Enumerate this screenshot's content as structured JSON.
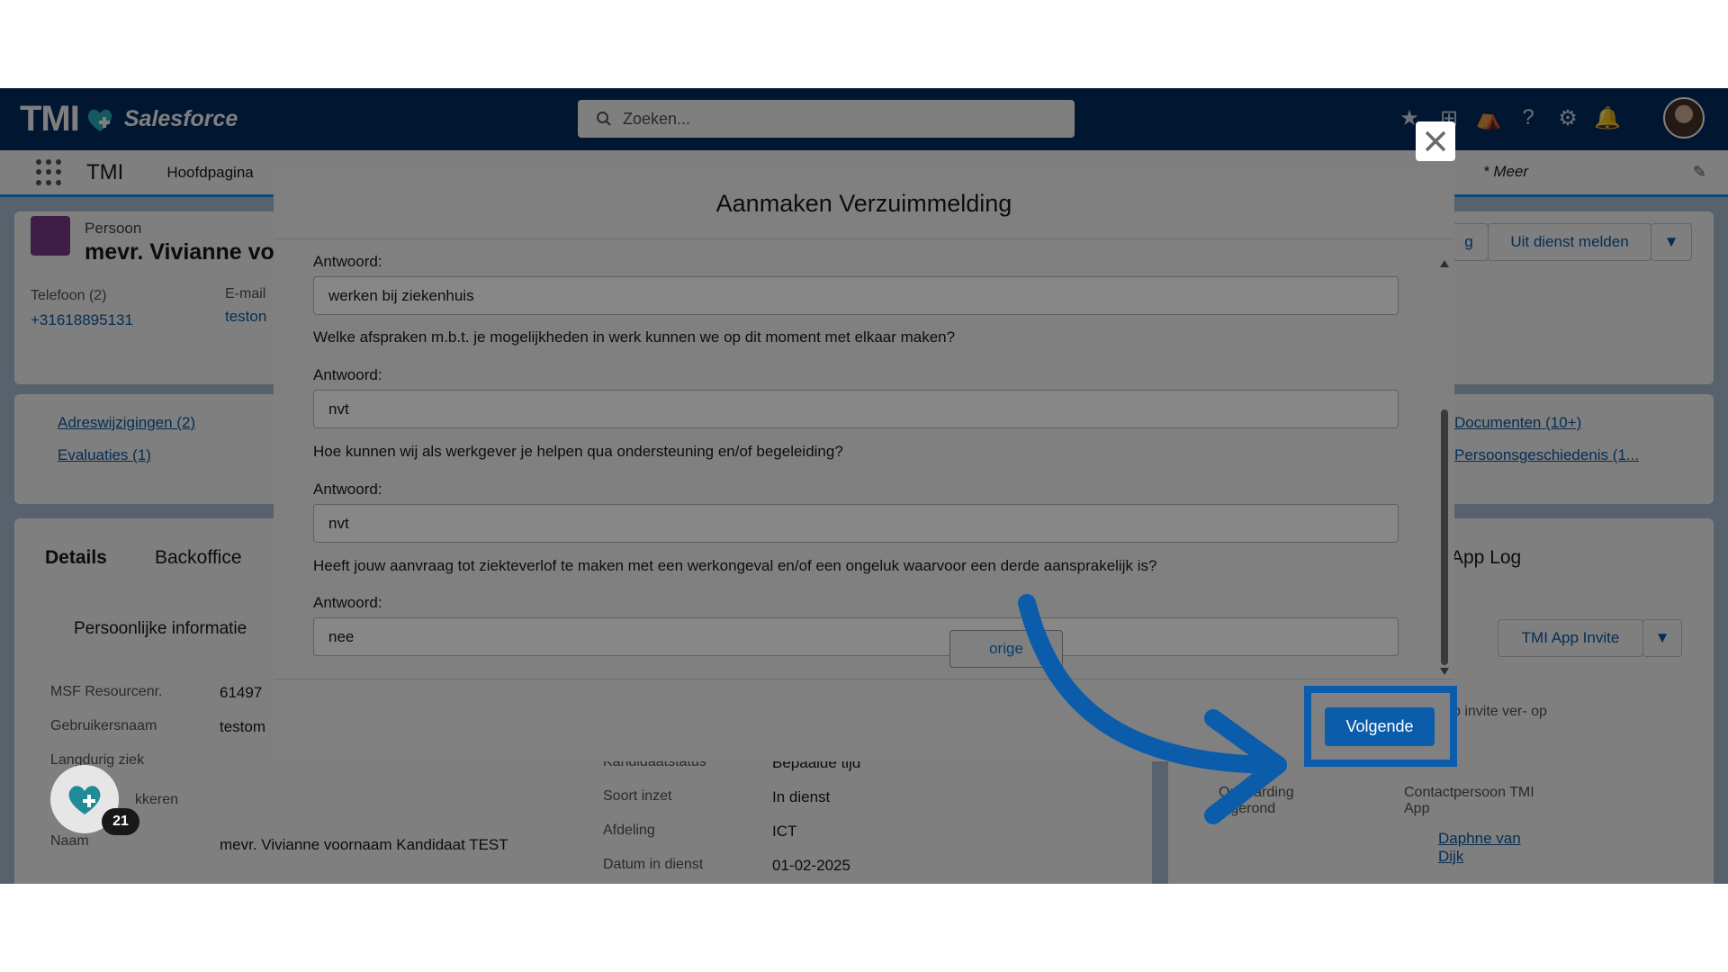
{
  "app": {
    "logo_text": "TMI",
    "brand": "Salesforce",
    "search_placeholder": "Zoeken...",
    "app_name": "TMI",
    "nav_home": "Hoofdpagina",
    "nav_more": "* Meer"
  },
  "record": {
    "type": "Persoon",
    "name": "mevr. Vivianne vo",
    "phone_label": "Telefoon (2)",
    "phone_value": "+31618895131",
    "email_label": "E-mail",
    "email_value": "teston",
    "action_label": "Uit dienst melden",
    "action_partial": "g"
  },
  "related": {
    "adres": "Adreswijzigingen (2)",
    "evaluaties": "Evaluaties (1)",
    "documenten": "Documenten (10+)",
    "persoonsgeschiedenis": "Persoonsgeschiedenis (1..."
  },
  "tabs": {
    "details": "Details",
    "backoffice": "Backoffice",
    "app_log": "App Log"
  },
  "details": {
    "section": "Persoonlijke informatie",
    "fields": [
      {
        "label": "MSF Resourcenr.",
        "value": "61497"
      },
      {
        "label": "Gebruikersnaam",
        "value": "testom"
      },
      {
        "label": "Langdurig ziek",
        "value": ""
      },
      {
        "label": "kkeren",
        "value": ""
      },
      {
        "label": "Naam",
        "value": "mevr. Vivianne voornaam Kandidaat TEST"
      }
    ],
    "mid_fields": [
      {
        "label": "Kandidaatstatus",
        "value": "Bepaalde tijd"
      },
      {
        "label": "Soort inzet",
        "value": "In dienst"
      },
      {
        "label": "Afdeling",
        "value": "ICT"
      },
      {
        "label": "Datum in dienst",
        "value": "01-02-2025"
      }
    ]
  },
  "right_panel": {
    "invite_button": "TMI App Invite",
    "invite_text": "p invite ver- op",
    "onboarding_label": "Onboarding afgerond",
    "contact_label": "Contactpersoon TMI App",
    "contact_value": "Daphne van Dijk"
  },
  "fab": {
    "badge": "21"
  },
  "modal": {
    "title": "Aanmaken Verzuimmelding",
    "answer_label": "Antwoord:",
    "questions": [
      {
        "question": "",
        "answer": "werken bij ziekenhuis"
      },
      {
        "question": "Welke afspraken m.b.t. je mogelijkheden in werk kunnen we op dit moment met elkaar maken?",
        "answer": "nvt"
      },
      {
        "question": "Hoe kunnen wij als werkgever je helpen qua ondersteuning en/of begeleiding?",
        "answer": "nvt"
      },
      {
        "question": "Heeft jouw aanvraag tot ziekteverlof te maken met een werkongeval en/of een ongeluk waarvoor een derde aansprakelijk is?",
        "answer": "nee"
      }
    ],
    "prev_button": "orige",
    "next_button": "Volgende"
  },
  "colors": {
    "header_navy": "#032d60",
    "brand_blue": "#0b5cab",
    "highlight_blue": "#0b5cab"
  }
}
